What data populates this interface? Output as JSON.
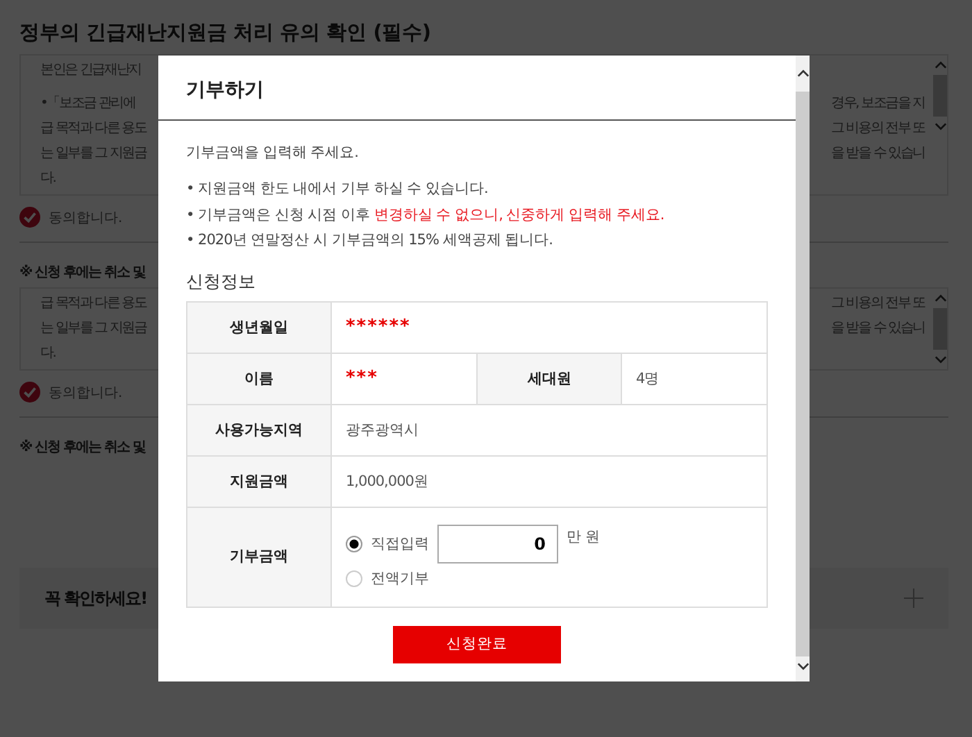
{
  "background": {
    "title": "정부의 긴급재난지원금 처리 유의 확인 (필수)",
    "sections": [
      {
        "lines": [
          {
            "left": "본인은 긴급재난지"
          },
          {
            "left": "•「보조금 관리에",
            "right": "경우, 보조금을 지"
          },
          {
            "left": "급 목적과 다른 용도",
            "right": "그 비용의 전부 또"
          },
          {
            "left": "는 일부를 그 지원금",
            "right": "을 받을 수 있습니"
          },
          {
            "left": "다."
          }
        ],
        "agree": {
          "label": "동의합니다.",
          "checked": true
        }
      },
      {
        "notice": "※ 신청 후에는 취소 및",
        "lines": [
          {
            "left": "급 목적과 다른 용도",
            "right": "그 비용의 전부 또"
          },
          {
            "left": "는 일부를 그 지원금",
            "right": "을 받을 수 있습니"
          },
          {
            "left": "다."
          }
        ],
        "agree": {
          "label": "동의합니다.",
          "checked": true
        }
      }
    ],
    "notice": "※ 신청 후에는 취소 및",
    "panel": {
      "title": "꼭 확인하세요!",
      "expanded": false
    }
  },
  "modal": {
    "title": "기부하기",
    "intro": "기부금액을 입력해 주세요.",
    "bullets": [
      {
        "text": "• 지원금액 한도 내에서 기부 하실 수 있습니다."
      },
      {
        "text": "• 기부금액은 신청 시점 이후 ",
        "highlight": "변경하실 수 없으니, 신중하게 입력해 주세요."
      },
      {
        "text": "• 2020년 연말정산 시 기부금액의 15% 세액공제 됩니다."
      }
    ],
    "section_title": "신청정보",
    "rows": [
      [
        {
          "label": "생년월일",
          "kind": "masked",
          "value": "******"
        }
      ],
      [
        {
          "label": "이름",
          "kind": "masked",
          "value": "***"
        },
        {
          "label": "세대원",
          "kind": "text",
          "value": "4명"
        }
      ],
      [
        {
          "label": "사용가능지역",
          "kind": "text",
          "value": "광주광역시"
        }
      ],
      [
        {
          "label": "지원금액",
          "kind": "text",
          "value": "1,000,000원"
        }
      ],
      [
        {
          "label": "기부금액",
          "kind": "donation",
          "options": [
            {
              "label": "직접입력",
              "selected": true,
              "input": "0",
              "unit": "만 원"
            },
            {
              "label": "전액기부",
              "selected": false
            }
          ]
        }
      ]
    ],
    "submit": "신청완료"
  }
}
